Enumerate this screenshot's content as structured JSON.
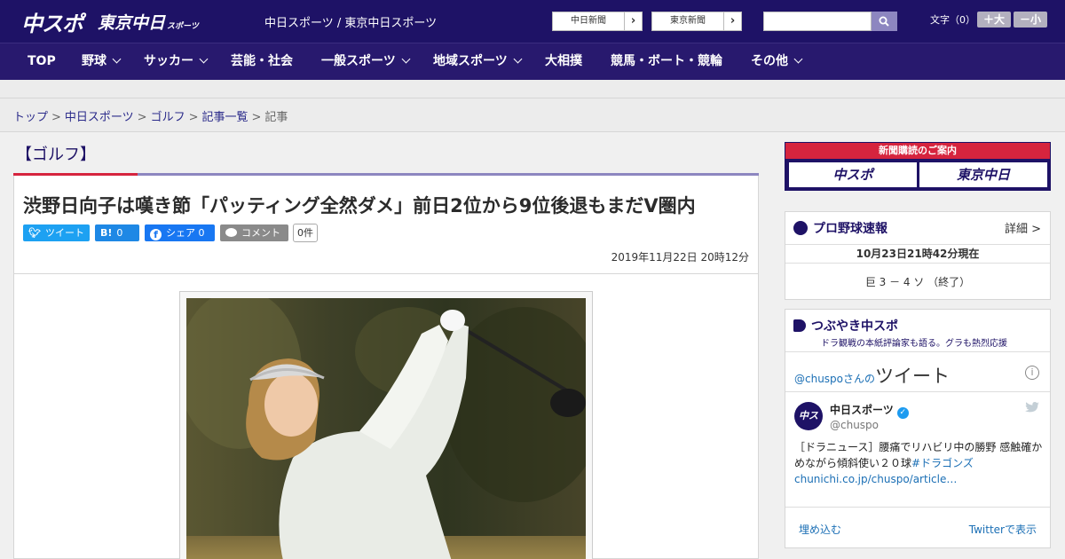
{
  "header": {
    "logo_main": "中スポ",
    "logo_tokyo": "東京中日",
    "logo_tokyo_sub": "スポーツ",
    "site_name": "中日スポーツ / 東京中日スポーツ",
    "ext_links": [
      "中日新聞",
      "東京新聞"
    ],
    "search_placeholder": "",
    "font_size_label": "文字（0）",
    "font_bigger": "＋大",
    "font_smaller": "－小",
    "brand_color": "#1e1266",
    "accent_color": "#d6243e"
  },
  "nav": [
    {
      "label": "TOP",
      "has_menu": false
    },
    {
      "label": "野球",
      "has_menu": true
    },
    {
      "label": "サッカー",
      "has_menu": true
    },
    {
      "label": "芸能・社会",
      "has_menu": false
    },
    {
      "label": "一般スポーツ",
      "has_menu": true
    },
    {
      "label": "地域スポーツ",
      "has_menu": true
    },
    {
      "label": "大相撲",
      "has_menu": false
    },
    {
      "label": "競馬・ボート・競輪",
      "has_menu": false
    },
    {
      "label": "その他",
      "has_menu": true
    }
  ],
  "breadcrumb": {
    "items": [
      "トップ",
      "中日スポーツ",
      "ゴルフ",
      "記事一覧"
    ],
    "current": "記事",
    "separator": ">"
  },
  "article": {
    "category": "【ゴルフ】",
    "headline": "渋野日向子は嘆き節「パッティング全然ダメ」前日2位から9位後退もまだV圏内",
    "share": {
      "tweet": "ツイート",
      "hatena": "B!",
      "hatena_count": "0",
      "facebook": "シェア",
      "facebook_count": "0",
      "comment": "コメント",
      "comment_count": "0件"
    },
    "date": "2019年11月22日 20時12分"
  },
  "sidebar": {
    "subscribe": {
      "title": "新聞購読のご案内",
      "logo1": "中スポ",
      "logo2": "東京中日"
    },
    "baseball": {
      "title": "プロ野球速報",
      "detail": "詳細 >",
      "timestamp": "10月23日21時42分現在",
      "score": "巨 3 － 4 ソ （終了）"
    },
    "tweets": {
      "title": "つぶやき中スポ",
      "subtitle": "ドラ観戦の本紙評論家も語る。グラも熱烈応援",
      "handle": "@chuspo",
      "handle_suffix": "さんの",
      "heading": "ツイート",
      "tweet_name": "中日スポーツ",
      "tweet_user": "@chuspo",
      "avatar_text": "中スポ",
      "tweet_text": "［ドラニュース］腰痛でリハビリ中の勝野 感触確かめながら傾斜使い２０球",
      "tweet_tag": "#ドラゴンズ",
      "tweet_link": "chunichi.co.jp/chuspo/article…",
      "embed": "埋め込む",
      "view": "Twitterで表示"
    }
  }
}
